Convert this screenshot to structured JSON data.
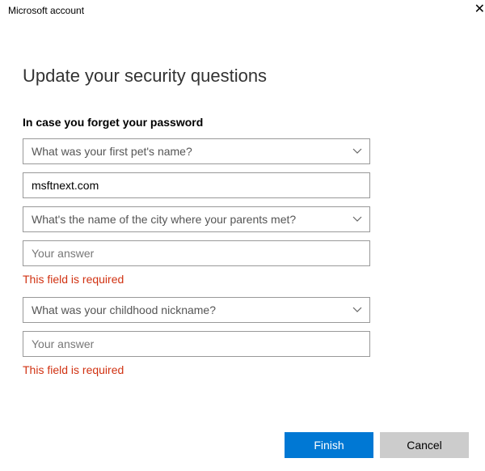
{
  "window": {
    "title": "Microsoft account"
  },
  "page": {
    "title": "Update your security questions",
    "subtitle": "In case you forget your password"
  },
  "questions": [
    {
      "selected": "What was your first pet's name?",
      "answer_value": "msftnext.com",
      "answer_placeholder": "Your answer",
      "error": ""
    },
    {
      "selected": "What's the name of the city where your parents met?",
      "answer_value": "",
      "answer_placeholder": "Your answer",
      "error": "This field is required"
    },
    {
      "selected": "What was your childhood nickname?",
      "answer_value": "",
      "answer_placeholder": "Your answer",
      "error": "This field is required"
    }
  ],
  "buttons": {
    "finish": "Finish",
    "cancel": "Cancel"
  }
}
